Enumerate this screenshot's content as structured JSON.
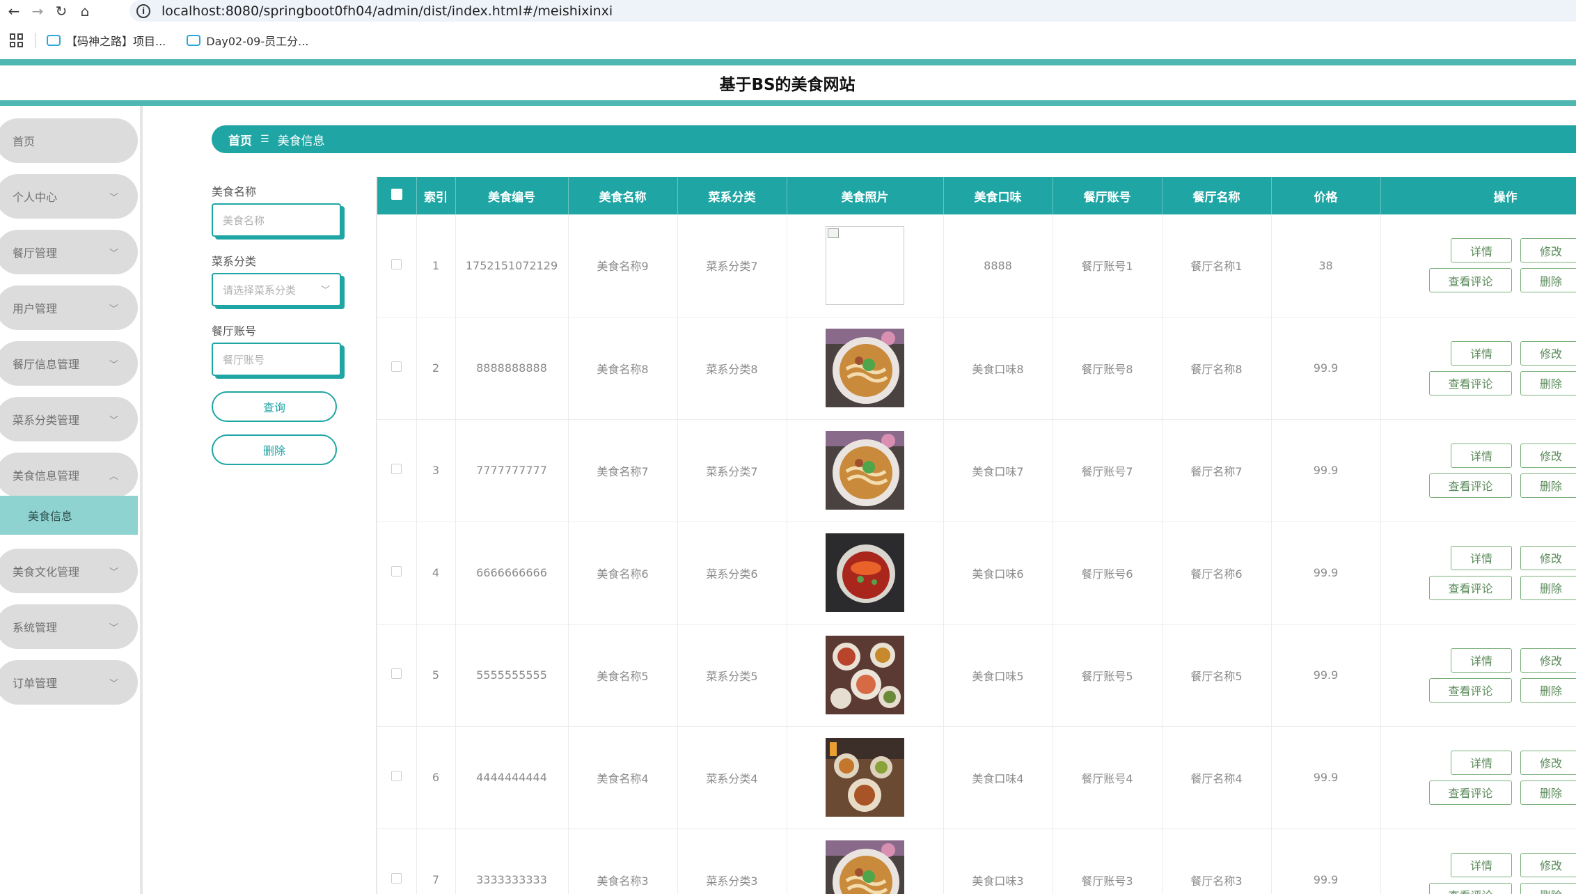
{
  "browser": {
    "url": "localhost:8080/springboot0fh04/admin/dist/index.html#/meishixinxi",
    "bookmarks": [
      "【码神之路】项目...",
      "Day02-09-员工分..."
    ]
  },
  "app": {
    "title": "基于BS的美食网站"
  },
  "sidebar": {
    "items": [
      {
        "label": "首页",
        "chevron": ""
      },
      {
        "label": "个人中心",
        "chevron": "﹀"
      },
      {
        "label": "餐厅管理",
        "chevron": "﹀"
      },
      {
        "label": "用户管理",
        "chevron": "﹀"
      },
      {
        "label": "餐厅信息管理",
        "chevron": "﹀"
      },
      {
        "label": "菜系分类管理",
        "chevron": "﹀"
      },
      {
        "label": "美食信息管理",
        "chevron": "︿"
      },
      {
        "label": "美食文化管理",
        "chevron": "﹀"
      },
      {
        "label": "系统管理",
        "chevron": "﹀"
      },
      {
        "label": "订单管理",
        "chevron": "﹀"
      }
    ],
    "active_sub": "美食信息"
  },
  "breadcrumb": {
    "home": "首页",
    "separator": "☰",
    "current": "美食信息"
  },
  "search": {
    "name_label": "美食名称",
    "name_placeholder": "美食名称",
    "category_label": "菜系分类",
    "category_placeholder": "请选择菜系分类",
    "account_label": "餐厅账号",
    "account_placeholder": "餐厅账号",
    "query_button": "查询",
    "delete_button": "删除"
  },
  "table": {
    "columns": [
      "索引",
      "美食编号",
      "美食名称",
      "菜系分类",
      "美食照片",
      "美食口味",
      "餐厅账号",
      "餐厅名称",
      "价格",
      "操作"
    ],
    "actions": {
      "detail": "详情",
      "edit": "修改",
      "reviews": "查看评论",
      "delete": "删除"
    },
    "rows": [
      {
        "index": "1",
        "code": "1752151072129",
        "name": "美食名称9",
        "category": "菜系分类7",
        "photo": "broken",
        "taste": "8888",
        "account": "餐厅账号1",
        "restaurant": "餐厅名称1",
        "price": "38"
      },
      {
        "index": "2",
        "code": "8888888888",
        "name": "美食名称8",
        "category": "菜系分类8",
        "photo": "noodle-soup",
        "taste": "美食口味8",
        "account": "餐厅账号8",
        "restaurant": "餐厅名称8",
        "price": "99.9"
      },
      {
        "index": "3",
        "code": "7777777777",
        "name": "美食名称7",
        "category": "菜系分类7",
        "photo": "noodle-soup",
        "taste": "美食口味7",
        "account": "餐厅账号7",
        "restaurant": "餐厅名称7",
        "price": "99.9"
      },
      {
        "index": "4",
        "code": "6666666666",
        "name": "美食名称6",
        "category": "菜系分类6",
        "photo": "lobster",
        "taste": "美食口味6",
        "account": "餐厅账号6",
        "restaurant": "餐厅名称6",
        "price": "99.9"
      },
      {
        "index": "5",
        "code": "5555555555",
        "name": "美食名称5",
        "category": "菜系分类5",
        "photo": "dishes-table",
        "taste": "美食口味5",
        "account": "餐厅账号5",
        "restaurant": "餐厅名称5",
        "price": "99.9"
      },
      {
        "index": "6",
        "code": "4444444444",
        "name": "美食名称4",
        "category": "菜系分类4",
        "photo": "feast",
        "taste": "美食口味4",
        "account": "餐厅账号4",
        "restaurant": "餐厅名称4",
        "price": "99.9"
      },
      {
        "index": "7",
        "code": "3333333333",
        "name": "美食名称3",
        "category": "菜系分类3",
        "photo": "noodle-soup",
        "taste": "美食口味3",
        "account": "餐厅账号3",
        "restaurant": "餐厅名称3",
        "price": "99.9"
      }
    ]
  },
  "colors": {
    "accent": "#1fa6a4",
    "sidebar_item": "#dcdcdc",
    "active_sub": "#8ed3d0"
  }
}
